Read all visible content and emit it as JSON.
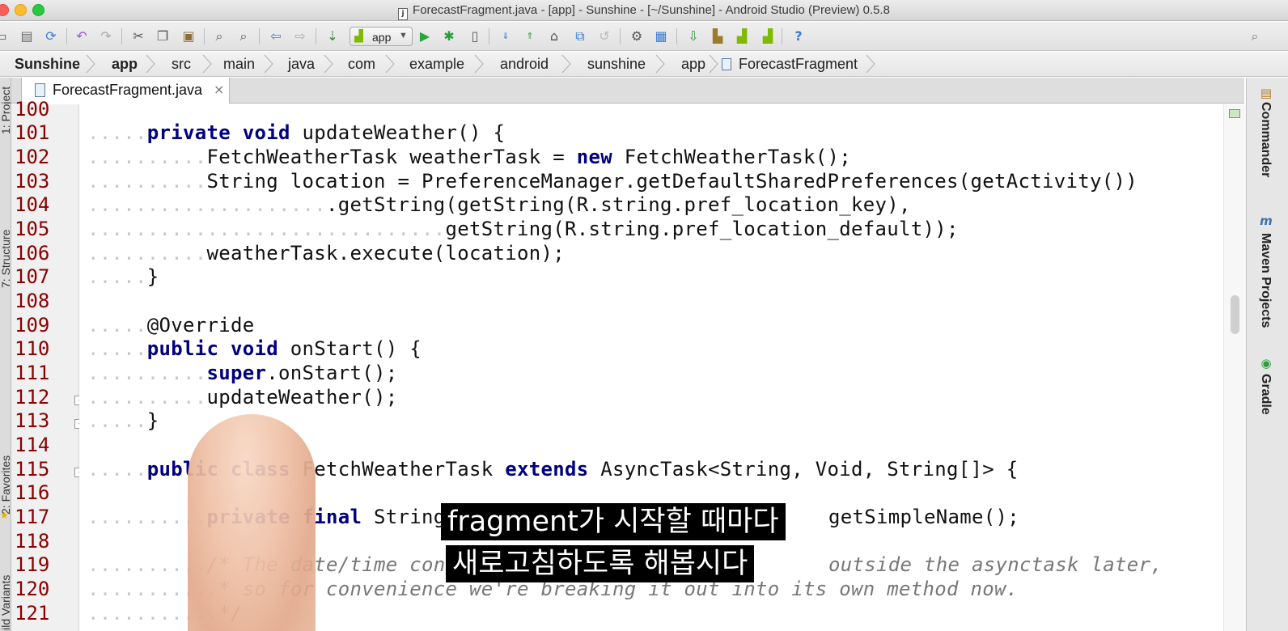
{
  "window": {
    "title": "ForecastFragment.java - [app] - Sunshine - [~/Sunshine] - Android Studio (Preview) 0.5.8",
    "file_glyph": "j"
  },
  "toolbar": {
    "run_config": "app",
    "icons": [
      "open-icon",
      "save-icon",
      "sync-icon",
      "undo-icon",
      "redo-icon",
      "cut-icon",
      "copy-icon",
      "paste-icon",
      "find-icon",
      "replace-icon",
      "back-icon",
      "forward-icon",
      "make-icon",
      "run-icon",
      "debug-icon",
      "attach-debugger-icon",
      "vcs-update-icon",
      "vcs-commit-icon",
      "vcs-push-icon",
      "compare-icon",
      "revert-icon",
      "settings-icon",
      "project-structure-icon",
      "sdk-manager-icon",
      "avd-manager-icon",
      "android-device-monitor-icon",
      "android-icon",
      "help-icon"
    ]
  },
  "breadcrumbs": [
    "Sunshine",
    "app",
    "src",
    "main",
    "java",
    "com",
    "example",
    "android",
    "sunshine",
    "app",
    "ForecastFragment"
  ],
  "editor": {
    "tab_label": "ForecastFragment.java",
    "tab_close": "×",
    "lines": [
      {
        "num": "100",
        "text": ""
      },
      {
        "num": "101",
        "text": "private void updateWeather() {"
      },
      {
        "num": "102",
        "text": "FetchWeatherTask weatherTask = new FetchWeatherTask();"
      },
      {
        "num": "103",
        "text": "String location = PreferenceManager.getDefaultSharedPreferences(getActivity())"
      },
      {
        "num": "104",
        "text": ".getString(getString(R.string.pref_location_key),"
      },
      {
        "num": "105",
        "text": "getString(R.string.pref_location_default));"
      },
      {
        "num": "106",
        "text": "weatherTask.execute(location);"
      },
      {
        "num": "107",
        "text": "}"
      },
      {
        "num": "108",
        "text": ""
      },
      {
        "num": "109",
        "text": "@Override"
      },
      {
        "num": "110",
        "text": "public void onStart() {"
      },
      {
        "num": "111",
        "text": "super.onStart();"
      },
      {
        "num": "112",
        "text": "updateWeather();"
      },
      {
        "num": "113",
        "text": "}"
      },
      {
        "num": "114",
        "text": ""
      },
      {
        "num": "115",
        "text": "public class FetchWeatherTask extends AsyncTask<String, Void, String[]> {"
      },
      {
        "num": "116",
        "text": ""
      },
      {
        "num": "117",
        "text": "private final String L"
      },
      {
        "num": "117b",
        "text": "getSimpleName();"
      },
      {
        "num": "118",
        "text": ""
      },
      {
        "num": "119",
        "text": "/* The date/time conve"
      },
      {
        "num": "119b",
        "text": "outside the asynctask later,"
      },
      {
        "num": "120",
        "text": "* so for convenience we're breaking it out into its own method now."
      },
      {
        "num": "121",
        "text": "*/"
      }
    ]
  },
  "tool_windows": {
    "left": [
      "1: Project",
      "7: Structure",
      "2: Favorites",
      "Build Variants"
    ],
    "right": [
      "Commander",
      "Maven Projects",
      "Gradle"
    ]
  },
  "subtitles": {
    "line1": "fragment가 시작할 때마다",
    "line2": "새로고침하도록 해봅시다"
  },
  "colors": {
    "keyword": "#000080",
    "line_number": "#8b0000",
    "comment": "#777777"
  }
}
